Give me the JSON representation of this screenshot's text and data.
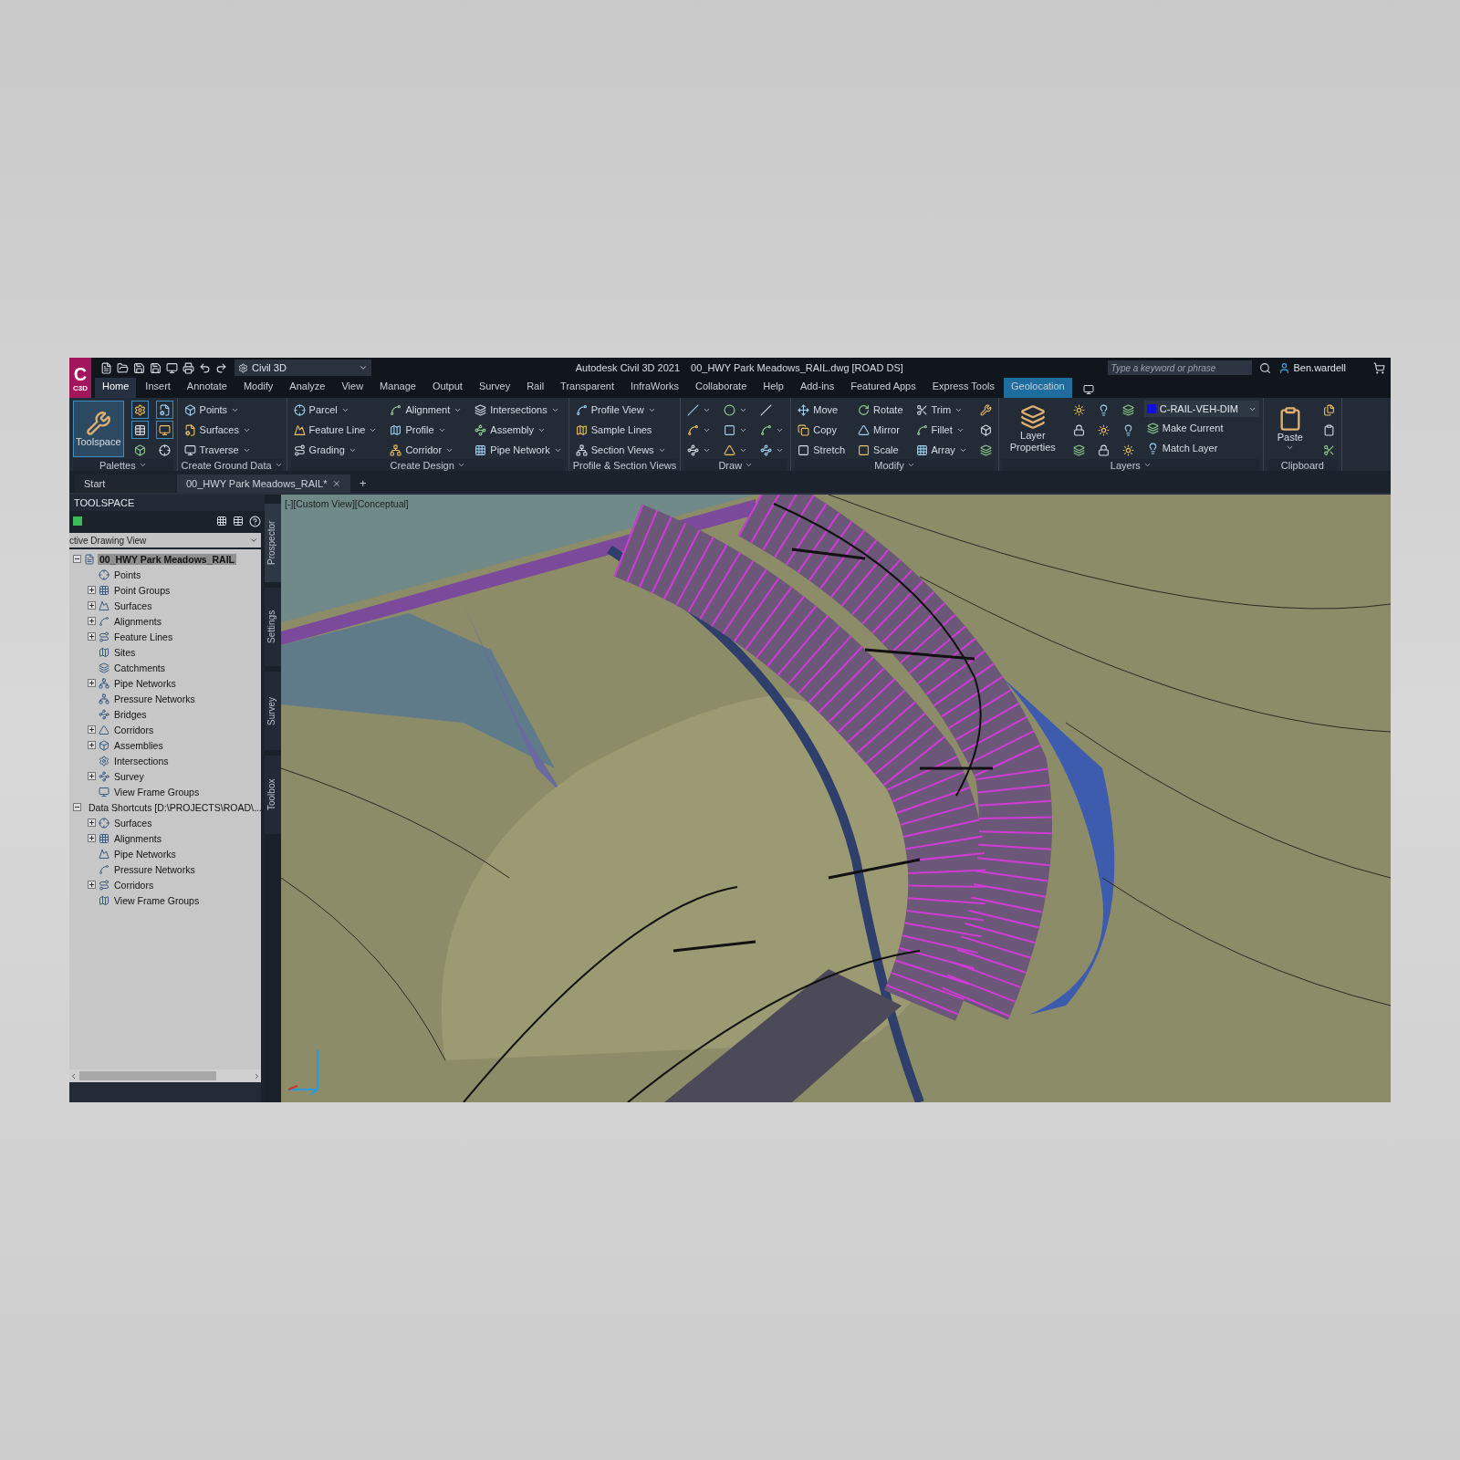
{
  "title_bar": {
    "logo": "C",
    "logo_sub": "C3D",
    "workspace": "Civil 3D",
    "app_title": "Autodesk Civil 3D 2021",
    "file_title": "00_HWY Park Meadows_RAIL.dwg [ROAD DS]",
    "search": {
      "placeholder": "Type a keyword or phrase"
    },
    "user": "Ben.wardell"
  },
  "menu_tabs": [
    {
      "label": "Home",
      "selected": true,
      "kind": "standard"
    },
    {
      "label": "Insert",
      "selected": false,
      "kind": "standard"
    },
    {
      "label": "Annotate",
      "selected": false,
      "kind": "standard"
    },
    {
      "label": "Modify",
      "selected": false,
      "kind": "standard"
    },
    {
      "label": "Analyze",
      "selected": false,
      "kind": "standard"
    },
    {
      "label": "View",
      "selected": false,
      "kind": "standard"
    },
    {
      "label": "Manage",
      "selected": false,
      "kind": "standard"
    },
    {
      "label": "Output",
      "selected": false,
      "kind": "standard"
    },
    {
      "label": "Survey",
      "selected": false,
      "kind": "standard"
    },
    {
      "label": "Rail",
      "selected": false,
      "kind": "standard"
    },
    {
      "label": "Transparent",
      "selected": false,
      "kind": "standard"
    },
    {
      "label": "InfraWorks",
      "selected": false,
      "kind": "standard"
    },
    {
      "label": "Collaborate",
      "selected": false,
      "kind": "standard"
    },
    {
      "label": "Help",
      "selected": false,
      "kind": "standard"
    },
    {
      "label": "Add-ins",
      "selected": false,
      "kind": "standard"
    },
    {
      "label": "Featured Apps",
      "selected": false,
      "kind": "standard"
    },
    {
      "label": "Express Tools",
      "selected": false,
      "kind": "standard"
    },
    {
      "label": "Geolocation",
      "selected": false,
      "kind": "contextual"
    }
  ],
  "ribbon_panels": [
    {
      "title": "Palettes",
      "menu": true,
      "columns": [
        [
          {
            "kind": "large",
            "label": "Toolspace",
            "active": true,
            "dropdown": false
          }
        ],
        [
          {
            "kind": "icon",
            "active": true,
            "dropdown": false
          },
          {
            "kind": "icon",
            "active": true,
            "dropdown": false
          },
          {
            "kind": "icon",
            "active": false,
            "dropdown": false
          }
        ],
        [
          {
            "kind": "icon",
            "active": true,
            "dropdown": false
          },
          {
            "kind": "icon",
            "active": true,
            "dropdown": false
          },
          {
            "kind": "icon",
            "active": false,
            "dropdown": false
          }
        ]
      ]
    },
    {
      "title": "Create Ground Data",
      "menu": true,
      "columns": [
        [
          {
            "kind": "small",
            "label": "Points",
            "active": false,
            "dropdown": true
          },
          {
            "kind": "small",
            "label": "Surfaces",
            "active": false,
            "dropdown": true
          },
          {
            "kind": "small",
            "label": "Traverse",
            "active": false,
            "dropdown": true
          }
        ]
      ]
    },
    {
      "title": "Create Design",
      "menu": true,
      "columns": [
        [
          {
            "kind": "small",
            "label": "Parcel",
            "active": false,
            "dropdown": true
          },
          {
            "kind": "small",
            "label": "Feature Line",
            "active": false,
            "dropdown": true
          },
          {
            "kind": "small",
            "label": "Grading",
            "active": false,
            "dropdown": true
          }
        ],
        [
          {
            "kind": "small",
            "label": "Alignment",
            "active": false,
            "dropdown": true
          },
          {
            "kind": "small",
            "label": "Profile",
            "active": false,
            "dropdown": true
          },
          {
            "kind": "small",
            "label": "Corridor",
            "active": false,
            "dropdown": true
          }
        ],
        [
          {
            "kind": "small",
            "label": "Intersections",
            "active": false,
            "dropdown": true
          },
          {
            "kind": "small",
            "label": "Assembly",
            "active": false,
            "dropdown": true
          },
          {
            "kind": "small",
            "label": "Pipe Network",
            "active": false,
            "dropdown": true
          }
        ]
      ]
    },
    {
      "title": "Profile & Section Views",
      "menu": false,
      "columns": [
        [
          {
            "kind": "small",
            "label": "Profile View",
            "active": false,
            "dropdown": true
          },
          {
            "kind": "small",
            "label": "Sample Lines",
            "active": false,
            "dropdown": false
          },
          {
            "kind": "small",
            "label": "Section Views",
            "active": false,
            "dropdown": true
          }
        ]
      ]
    },
    {
      "title": "Draw",
      "menu": true,
      "columns": [
        [
          {
            "kind": "icon",
            "active": false,
            "dropdown": true
          },
          {
            "kind": "icon",
            "active": false,
            "dropdown": true
          },
          {
            "kind": "icon",
            "active": false,
            "dropdown": true
          }
        ],
        [
          {
            "kind": "icon",
            "active": false,
            "dropdown": true
          },
          {
            "kind": "icon",
            "active": false,
            "dropdown": true
          },
          {
            "kind": "icon",
            "active": false,
            "dropdown": true
          }
        ],
        [
          {
            "kind": "icon",
            "active": false,
            "dropdown": false
          },
          {
            "kind": "icon",
            "active": false,
            "dropdown": true
          },
          {
            "kind": "icon",
            "active": false,
            "dropdown": true
          }
        ]
      ]
    },
    {
      "title": "Modify",
      "menu": true,
      "columns": [
        [
          {
            "kind": "small",
            "label": "Move",
            "active": false,
            "dropdown": false
          },
          {
            "kind": "small",
            "label": "Copy",
            "active": false,
            "dropdown": false
          },
          {
            "kind": "small",
            "label": "Stretch",
            "active": false,
            "dropdown": false
          }
        ],
        [
          {
            "kind": "small",
            "label": "Rotate",
            "active": false,
            "dropdown": false
          },
          {
            "kind": "small",
            "label": "Mirror",
            "active": false,
            "dropdown": false
          },
          {
            "kind": "small",
            "label": "Scale",
            "active": false,
            "dropdown": false
          }
        ],
        [
          {
            "kind": "small",
            "label": "Trim",
            "active": false,
            "dropdown": true
          },
          {
            "kind": "small",
            "label": "Fillet",
            "active": false,
            "dropdown": true
          },
          {
            "kind": "small",
            "label": "Array",
            "active": false,
            "dropdown": true
          }
        ],
        [
          {
            "kind": "icon",
            "active": false,
            "dropdown": false
          },
          {
            "kind": "icon",
            "active": false,
            "dropdown": false
          },
          {
            "kind": "icon",
            "active": false,
            "dropdown": false
          }
        ]
      ]
    },
    {
      "title": "Layers",
      "menu": true,
      "columns": [
        [
          {
            "kind": "large",
            "label": "Layer Properties",
            "active": false,
            "dropdown": false
          }
        ],
        [
          {
            "kind": "icon",
            "active": false,
            "dropdown": false
          },
          {
            "kind": "icon",
            "active": false,
            "dropdown": false
          },
          {
            "kind": "icon",
            "active": false,
            "dropdown": false
          }
        ],
        [
          {
            "kind": "icon",
            "active": false,
            "dropdown": false
          },
          {
            "kind": "icon",
            "active": false,
            "dropdown": false
          },
          {
            "kind": "icon",
            "active": false,
            "dropdown": false
          }
        ],
        [
          {
            "kind": "icon",
            "active": false,
            "dropdown": false
          },
          {
            "kind": "icon",
            "active": false,
            "dropdown": false
          },
          {
            "kind": "icon",
            "active": false,
            "dropdown": false
          }
        ],
        [
          {
            "kind": "select",
            "label": "C-RAIL-VEH-DIM",
            "active": false,
            "dropdown": true
          },
          {
            "kind": "small",
            "label": "Make Current",
            "active": false,
            "dropdown": false
          },
          {
            "kind": "small",
            "label": "Match Layer",
            "active": false,
            "dropdown": false
          }
        ]
      ]
    },
    {
      "title": "Clipboard",
      "menu": false,
      "columns": [
        [
          {
            "kind": "large",
            "label": "Paste",
            "active": false,
            "dropdown": true
          }
        ],
        [
          {
            "kind": "icon",
            "active": false,
            "dropdown": false
          },
          {
            "kind": "icon",
            "active": false,
            "dropdown": false
          },
          {
            "kind": "icon",
            "active": false,
            "dropdown": false
          }
        ]
      ]
    }
  ],
  "doc_tabs": [
    {
      "label": "Start",
      "selected": false,
      "closable": false
    },
    {
      "label": "00_HWY Park Meadows_RAIL*",
      "selected": true,
      "closable": true
    }
  ],
  "new_tab": "+",
  "toolspace": {
    "title": "TOOLSPACE",
    "view_select": "ctive Drawing View",
    "tree": [
      {
        "label": "00_HWY Park Meadows_RAIL",
        "expandable": true,
        "expanded": true,
        "selected": true,
        "children": [
          {
            "label": "Points",
            "expandable": false,
            "expanded": false,
            "selected": false
          },
          {
            "label": "Point Groups",
            "expandable": true,
            "expanded": false,
            "selected": false
          },
          {
            "label": "Surfaces",
            "expandable": true,
            "expanded": false,
            "selected": false
          },
          {
            "label": "Alignments",
            "expandable": true,
            "expanded": false,
            "selected": false
          },
          {
            "label": "Feature Lines",
            "expandable": true,
            "expanded": false,
            "selected": false
          },
          {
            "label": "Sites",
            "expandable": false,
            "expanded": false,
            "selected": false
          },
          {
            "label": "Catchments",
            "expandable": false,
            "expanded": false,
            "selected": false
          },
          {
            "label": "Pipe Networks",
            "expandable": true,
            "expanded": false,
            "selected": false
          },
          {
            "label": "Pressure Networks",
            "expandable": false,
            "expanded": false,
            "selected": false
          },
          {
            "label": "Bridges",
            "expandable": false,
            "expanded": false,
            "selected": false
          },
          {
            "label": "Corridors",
            "expandable": true,
            "expanded": false,
            "selected": false
          },
          {
            "label": "Assemblies",
            "expandable": true,
            "expanded": false,
            "selected": false
          },
          {
            "label": "Intersections",
            "expandable": false,
            "expanded": false,
            "selected": false
          },
          {
            "label": "Survey",
            "expandable": true,
            "expanded": false,
            "selected": false
          },
          {
            "label": "View Frame Groups",
            "expandable": false,
            "expanded": false,
            "selected": false
          }
        ]
      },
      {
        "label": "Data Shortcuts [D:\\PROJECTS\\ROAD\\...",
        "expandable": true,
        "expanded": true,
        "selected": false,
        "children": [
          {
            "label": "Surfaces",
            "expandable": true,
            "expanded": false,
            "selected": false
          },
          {
            "label": "Alignments",
            "expandable": true,
            "expanded": false,
            "selected": false
          },
          {
            "label": "Pipe Networks",
            "expandable": false,
            "expanded": false,
            "selected": false
          },
          {
            "label": "Pressure Networks",
            "expandable": false,
            "expanded": false,
            "selected": false
          },
          {
            "label": "Corridors",
            "expandable": true,
            "expanded": false,
            "selected": false
          },
          {
            "label": "View Frame Groups",
            "expandable": false,
            "expanded": false,
            "selected": false
          }
        ]
      }
    ],
    "side_tabs": [
      {
        "label": "Prospector",
        "selected": true
      },
      {
        "label": "Settings",
        "selected": false
      },
      {
        "label": "Survey",
        "selected": false
      },
      {
        "label": "Toolbox",
        "selected": false
      }
    ]
  },
  "viewport": {
    "label": "[-][Custom View][Conceptual]"
  }
}
